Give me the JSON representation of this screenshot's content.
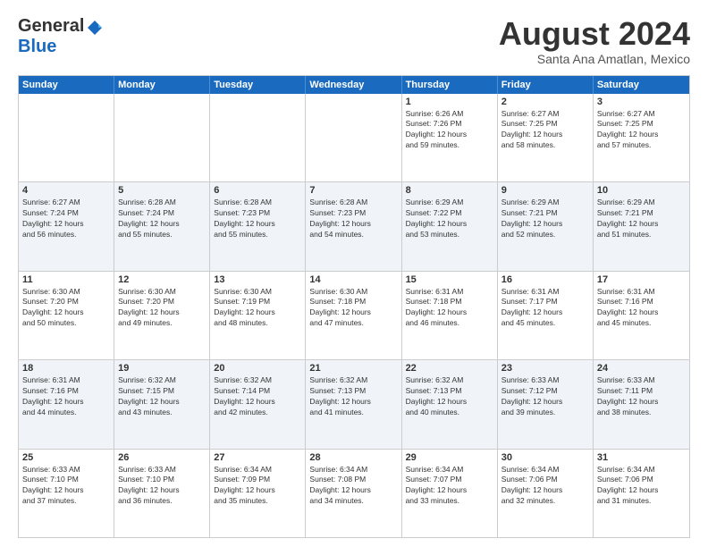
{
  "header": {
    "logo_general": "General",
    "logo_blue": "Blue",
    "month_title": "August 2024",
    "location": "Santa Ana Amatlan, Mexico"
  },
  "weekdays": [
    "Sunday",
    "Monday",
    "Tuesday",
    "Wednesday",
    "Thursday",
    "Friday",
    "Saturday"
  ],
  "rows": [
    {
      "alt": false,
      "cells": [
        {
          "day": "",
          "lines": []
        },
        {
          "day": "",
          "lines": []
        },
        {
          "day": "",
          "lines": []
        },
        {
          "day": "",
          "lines": []
        },
        {
          "day": "1",
          "lines": [
            "Sunrise: 6:26 AM",
            "Sunset: 7:26 PM",
            "Daylight: 12 hours",
            "and 59 minutes."
          ]
        },
        {
          "day": "2",
          "lines": [
            "Sunrise: 6:27 AM",
            "Sunset: 7:25 PM",
            "Daylight: 12 hours",
            "and 58 minutes."
          ]
        },
        {
          "day": "3",
          "lines": [
            "Sunrise: 6:27 AM",
            "Sunset: 7:25 PM",
            "Daylight: 12 hours",
            "and 57 minutes."
          ]
        }
      ]
    },
    {
      "alt": true,
      "cells": [
        {
          "day": "4",
          "lines": [
            "Sunrise: 6:27 AM",
            "Sunset: 7:24 PM",
            "Daylight: 12 hours",
            "and 56 minutes."
          ]
        },
        {
          "day": "5",
          "lines": [
            "Sunrise: 6:28 AM",
            "Sunset: 7:24 PM",
            "Daylight: 12 hours",
            "and 55 minutes."
          ]
        },
        {
          "day": "6",
          "lines": [
            "Sunrise: 6:28 AM",
            "Sunset: 7:23 PM",
            "Daylight: 12 hours",
            "and 55 minutes."
          ]
        },
        {
          "day": "7",
          "lines": [
            "Sunrise: 6:28 AM",
            "Sunset: 7:23 PM",
            "Daylight: 12 hours",
            "and 54 minutes."
          ]
        },
        {
          "day": "8",
          "lines": [
            "Sunrise: 6:29 AM",
            "Sunset: 7:22 PM",
            "Daylight: 12 hours",
            "and 53 minutes."
          ]
        },
        {
          "day": "9",
          "lines": [
            "Sunrise: 6:29 AM",
            "Sunset: 7:21 PM",
            "Daylight: 12 hours",
            "and 52 minutes."
          ]
        },
        {
          "day": "10",
          "lines": [
            "Sunrise: 6:29 AM",
            "Sunset: 7:21 PM",
            "Daylight: 12 hours",
            "and 51 minutes."
          ]
        }
      ]
    },
    {
      "alt": false,
      "cells": [
        {
          "day": "11",
          "lines": [
            "Sunrise: 6:30 AM",
            "Sunset: 7:20 PM",
            "Daylight: 12 hours",
            "and 50 minutes."
          ]
        },
        {
          "day": "12",
          "lines": [
            "Sunrise: 6:30 AM",
            "Sunset: 7:20 PM",
            "Daylight: 12 hours",
            "and 49 minutes."
          ]
        },
        {
          "day": "13",
          "lines": [
            "Sunrise: 6:30 AM",
            "Sunset: 7:19 PM",
            "Daylight: 12 hours",
            "and 48 minutes."
          ]
        },
        {
          "day": "14",
          "lines": [
            "Sunrise: 6:30 AM",
            "Sunset: 7:18 PM",
            "Daylight: 12 hours",
            "and 47 minutes."
          ]
        },
        {
          "day": "15",
          "lines": [
            "Sunrise: 6:31 AM",
            "Sunset: 7:18 PM",
            "Daylight: 12 hours",
            "and 46 minutes."
          ]
        },
        {
          "day": "16",
          "lines": [
            "Sunrise: 6:31 AM",
            "Sunset: 7:17 PM",
            "Daylight: 12 hours",
            "and 45 minutes."
          ]
        },
        {
          "day": "17",
          "lines": [
            "Sunrise: 6:31 AM",
            "Sunset: 7:16 PM",
            "Daylight: 12 hours",
            "and 45 minutes."
          ]
        }
      ]
    },
    {
      "alt": true,
      "cells": [
        {
          "day": "18",
          "lines": [
            "Sunrise: 6:31 AM",
            "Sunset: 7:16 PM",
            "Daylight: 12 hours",
            "and 44 minutes."
          ]
        },
        {
          "day": "19",
          "lines": [
            "Sunrise: 6:32 AM",
            "Sunset: 7:15 PM",
            "Daylight: 12 hours",
            "and 43 minutes."
          ]
        },
        {
          "day": "20",
          "lines": [
            "Sunrise: 6:32 AM",
            "Sunset: 7:14 PM",
            "Daylight: 12 hours",
            "and 42 minutes."
          ]
        },
        {
          "day": "21",
          "lines": [
            "Sunrise: 6:32 AM",
            "Sunset: 7:13 PM",
            "Daylight: 12 hours",
            "and 41 minutes."
          ]
        },
        {
          "day": "22",
          "lines": [
            "Sunrise: 6:32 AM",
            "Sunset: 7:13 PM",
            "Daylight: 12 hours",
            "and 40 minutes."
          ]
        },
        {
          "day": "23",
          "lines": [
            "Sunrise: 6:33 AM",
            "Sunset: 7:12 PM",
            "Daylight: 12 hours",
            "and 39 minutes."
          ]
        },
        {
          "day": "24",
          "lines": [
            "Sunrise: 6:33 AM",
            "Sunset: 7:11 PM",
            "Daylight: 12 hours",
            "and 38 minutes."
          ]
        }
      ]
    },
    {
      "alt": false,
      "cells": [
        {
          "day": "25",
          "lines": [
            "Sunrise: 6:33 AM",
            "Sunset: 7:10 PM",
            "Daylight: 12 hours",
            "and 37 minutes."
          ]
        },
        {
          "day": "26",
          "lines": [
            "Sunrise: 6:33 AM",
            "Sunset: 7:10 PM",
            "Daylight: 12 hours",
            "and 36 minutes."
          ]
        },
        {
          "day": "27",
          "lines": [
            "Sunrise: 6:34 AM",
            "Sunset: 7:09 PM",
            "Daylight: 12 hours",
            "and 35 minutes."
          ]
        },
        {
          "day": "28",
          "lines": [
            "Sunrise: 6:34 AM",
            "Sunset: 7:08 PM",
            "Daylight: 12 hours",
            "and 34 minutes."
          ]
        },
        {
          "day": "29",
          "lines": [
            "Sunrise: 6:34 AM",
            "Sunset: 7:07 PM",
            "Daylight: 12 hours",
            "and 33 minutes."
          ]
        },
        {
          "day": "30",
          "lines": [
            "Sunrise: 6:34 AM",
            "Sunset: 7:06 PM",
            "Daylight: 12 hours",
            "and 32 minutes."
          ]
        },
        {
          "day": "31",
          "lines": [
            "Sunrise: 6:34 AM",
            "Sunset: 7:06 PM",
            "Daylight: 12 hours",
            "and 31 minutes."
          ]
        }
      ]
    }
  ]
}
